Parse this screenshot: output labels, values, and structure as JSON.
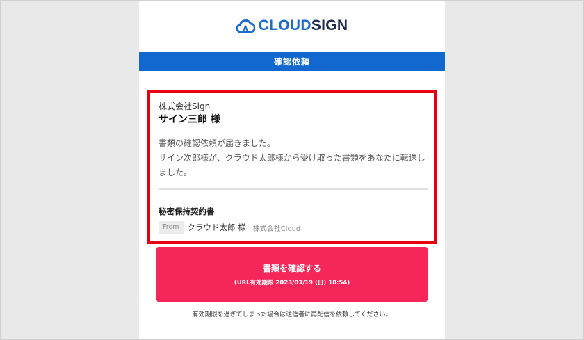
{
  "logo": {
    "icon": "cloud-pen-logo-icon",
    "text_part1": "CLOUD",
    "text_part2": "SIGN",
    "colors": {
      "cloud": "#1b6bd0",
      "sign": "#1e2b4d"
    }
  },
  "banner": {
    "title": "確認依頼",
    "color": "#1268cf"
  },
  "card": {
    "highlight_color": "#e60012",
    "company": "株式会社Sign",
    "recipient": "サイン三郎 様",
    "message_line1": "書類の確認依頼が届きました。",
    "message_line2": "サイン次郎様が、クラウド太郎様から受け取った書類をあなたに転送しました。",
    "document_title": "秘密保持契約書",
    "from_label": "From",
    "sender_name": "クラウド太郎 様",
    "sender_company": "株式会社Cloud"
  },
  "cta": {
    "label": "書類を確認する",
    "expiry": "(URL有効期限 2023/03/19 (日) 18:54)",
    "color": "#f5275a"
  },
  "footnote": "有効期限を過ぎてしまった場合は送信者に再配信を依頼してください。"
}
